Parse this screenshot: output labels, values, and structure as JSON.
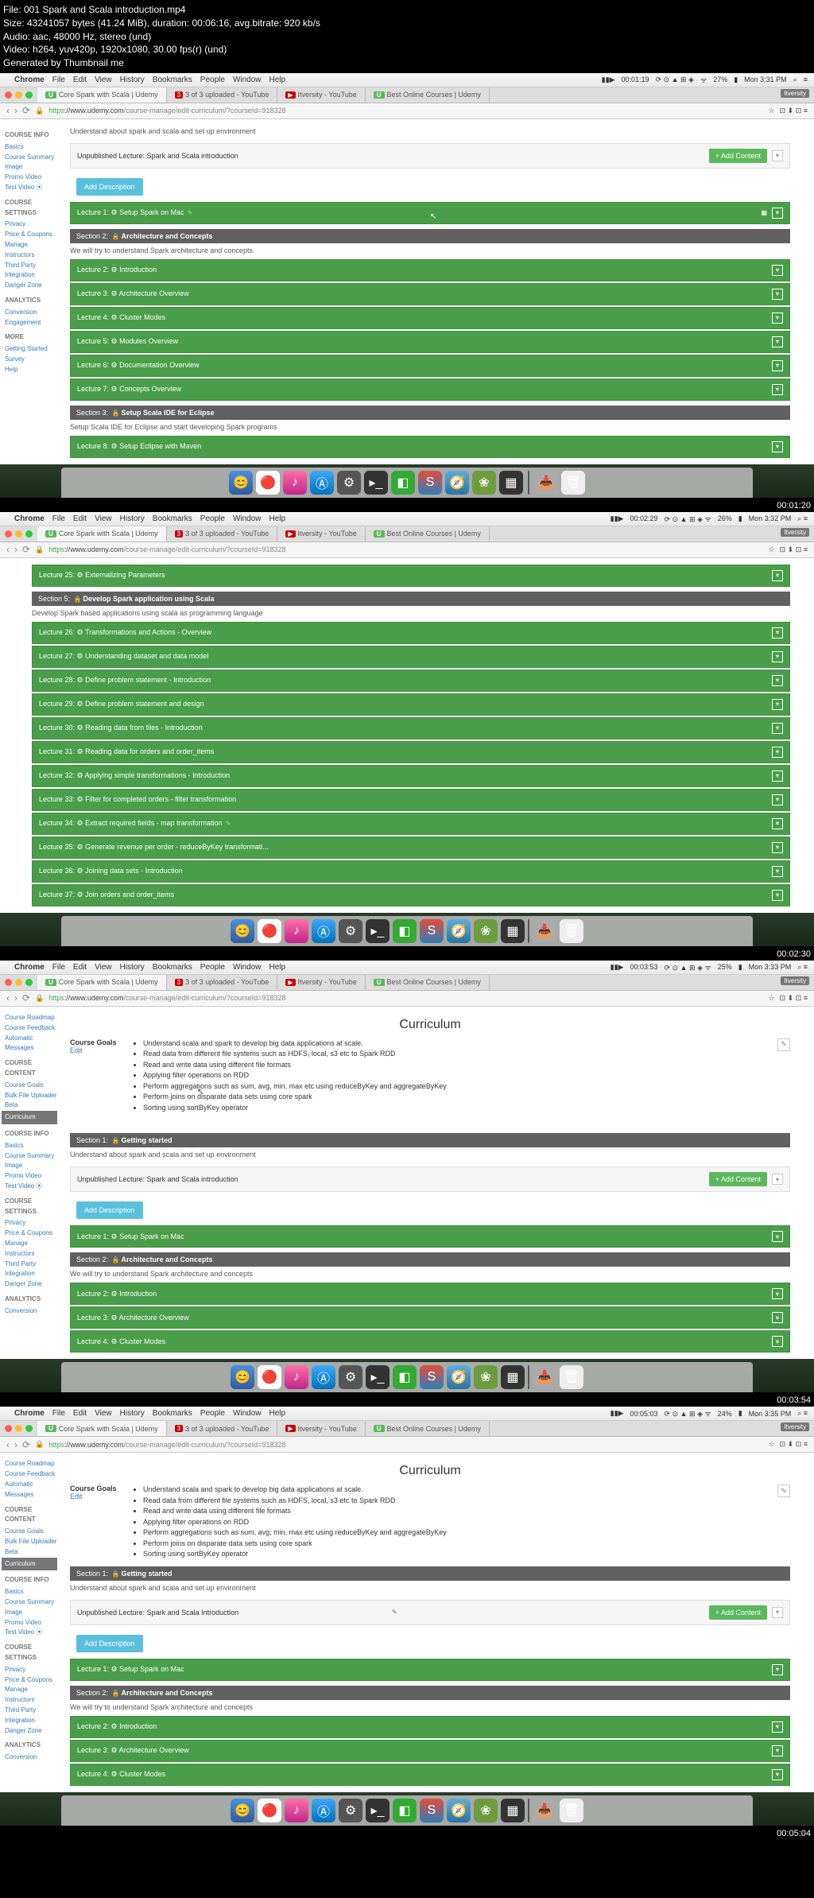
{
  "meta": {
    "file": "File: 001 Spark and Scala introduction.mp4",
    "size": "Size: 43241057 bytes (41.24 MiB), duration: 00:06:16, avg.bitrate: 920 kb/s",
    "audio": "Audio: aac, 48000 Hz, stereo (und)",
    "video": "Video: h264, yuv420p, 1920x1080, 30.00 fps(r) (und)",
    "gen": "Generated by Thumbnail me"
  },
  "timestamps": [
    "00:01:20",
    "00:02:30",
    "00:03:54",
    "00:05:04"
  ],
  "menubar": {
    "apple": "",
    "app": "Chrome",
    "items": [
      "File",
      "Edit",
      "View",
      "History",
      "Bookmarks",
      "People",
      "Window",
      "Help"
    ],
    "clocks": [
      "00:01:19",
      "00:02:29",
      "00:03:53",
      "00:05:03"
    ],
    "battery": [
      "27%",
      "26%",
      "25%",
      "24%"
    ],
    "times": [
      "Mon 3:31 PM",
      "Mon 3:32 PM",
      "Mon 3:33 PM",
      "Mon 3:35 PM"
    ]
  },
  "url": "https://www.udemy.com/course-manage/edit-curriculum/?courseId=918328",
  "url_host": "www.udemy.com",
  "url_path": "/course-manage/edit-curriculum/?courseId=918328",
  "tabs": {
    "t1": "Core Spark with Scala | Udemy",
    "t2_badge": "3",
    "t2": "3 of 3 uploaded - YouTube",
    "t3": "Itversity - YouTube",
    "t4": "Best Online Courses | Udemy"
  },
  "ext_label": "Itversity",
  "sidebar_full": {
    "groups": [
      {
        "h": "",
        "items": [
          "Course Roadmap",
          "Course Feedback",
          "Automatic Messages"
        ]
      },
      {
        "h": "COURSE CONTENT",
        "items": [
          "Course Goals",
          "Bulk File Uploader Beta"
        ],
        "active": "Curriculum"
      },
      {
        "h": "COURSE INFO",
        "items": [
          "Basics",
          "Course Summary",
          "Image",
          "Promo Video",
          "Test Video ⦿"
        ]
      },
      {
        "h": "COURSE SETTINGS",
        "items": [
          "Privacy",
          "Price & Coupons",
          "Manage Instructors",
          "Third Party Integration",
          "Danger Zone"
        ]
      },
      {
        "h": "ANALYTICS",
        "items": [
          "Conversion"
        ]
      }
    ]
  },
  "sidebar_short": {
    "groups": [
      {
        "h": "COURSE INFO",
        "items": [
          "Basics",
          "Course Summary",
          "Image",
          "Promo Video",
          "Test Video ⦿"
        ]
      },
      {
        "h": "COURSE SETTINGS",
        "items": [
          "Privacy",
          "Price & Coupons",
          "Manage Instructors",
          "Third Party Integration",
          "Danger Zone"
        ]
      },
      {
        "h": "ANALYTICS",
        "items": [
          "Conversion",
          "Engagement"
        ]
      },
      {
        "h": "MORE",
        "items": [
          "Getting Started",
          "Survey",
          "Help"
        ]
      }
    ]
  },
  "curriculum_title": "Curriculum",
  "goals_label": "Course Goals",
  "goals_edit": "Edit",
  "goals": [
    "Understand scala and spark to develop big data applications at scale.",
    "Read data from different file systems such as HDFS, local, s3 etc to Spark RDD",
    "Read and write data using different file formats",
    "Applying filter operations on RDD",
    "Perform aggregations such as sum, avg, min, max etc using reduceByKey and aggregateByKey",
    "Perform joins on disparate data sets using core spark",
    "Sorting using sortByKey operator"
  ],
  "sec1": {
    "label": "Section 1:",
    "title": "Getting started"
  },
  "sec1_desc": "Understand about spark and scala and set up environment",
  "unpub": "Unpublished Lecture: Spark and Scala introduction",
  "add_content": "+ Add Content",
  "add_desc": "Add Description",
  "lec1": "Lecture 1: ⚙ Setup Spark on Mac",
  "sec2": {
    "label": "Section 2:",
    "title": "Architecture and Concepts"
  },
  "sec2_desc": "We will try to understand Spark architecture and concepts",
  "lectures_a": [
    "Lecture 2: ⚙ Introduction",
    "Lecture 3: ⚙ Architecture Overview",
    "Lecture 4: ⚙ Cluster Modes",
    "Lecture 5: ⚙ Modules Overview",
    "Lecture 6: ⚙ Documentation Overview",
    "Lecture 7: ⚙ Concepts Overview"
  ],
  "sec3": {
    "label": "Section 3:",
    "title": "Setup Scala IDE for Eclipse"
  },
  "sec3_desc": "Setup Scala IDE for Eclipse and start developing Spark programs",
  "lec8": "Lecture 8: ⚙ Setup Eclipse with Maven",
  "lec25": "Lecture 25: ⚙ Externalizing Parameters",
  "sec5": {
    "label": "Section 5:",
    "title": "Develop Spark application using Scala"
  },
  "sec5_desc": "Develop Spark based applications using scala as programming language",
  "lectures_b": [
    "Lecture 26: ⚙ Transformations and Actions - Overview",
    "Lecture 27: ⚙ Understanding dataset and data model",
    "Lecture 28: ⚙ Define problem statement - Introduction",
    "Lecture 29: ⚙ Define problem statement and design",
    "Lecture 30: ⚙ Reading data from files - Introduction",
    "Lecture 31: ⚙ Reading data for orders and order_items",
    "Lecture 32: ⚙ Applying simple transformations - Introduction",
    "Lecture 33: ⚙ Filter for completed orders - filter transformation",
    "Lecture 34: ⚙ Extract required fields - map transformation",
    "Lecture 35: ⚙ Generate revenue per order - reduceByKey transformati...",
    "Lecture 36: ⚙ Joining data sets - Introduction",
    "Lecture 37: ⚙ Join orders and order_items"
  ],
  "lectures_c": [
    "Lecture 2: ⚙ Introduction",
    "Lecture 3: ⚙ Architecture Overview",
    "Lecture 4: ⚙ Cluster Modes"
  ],
  "unpub4": "Unpublished Lecture: Spark and Scala Introduction"
}
